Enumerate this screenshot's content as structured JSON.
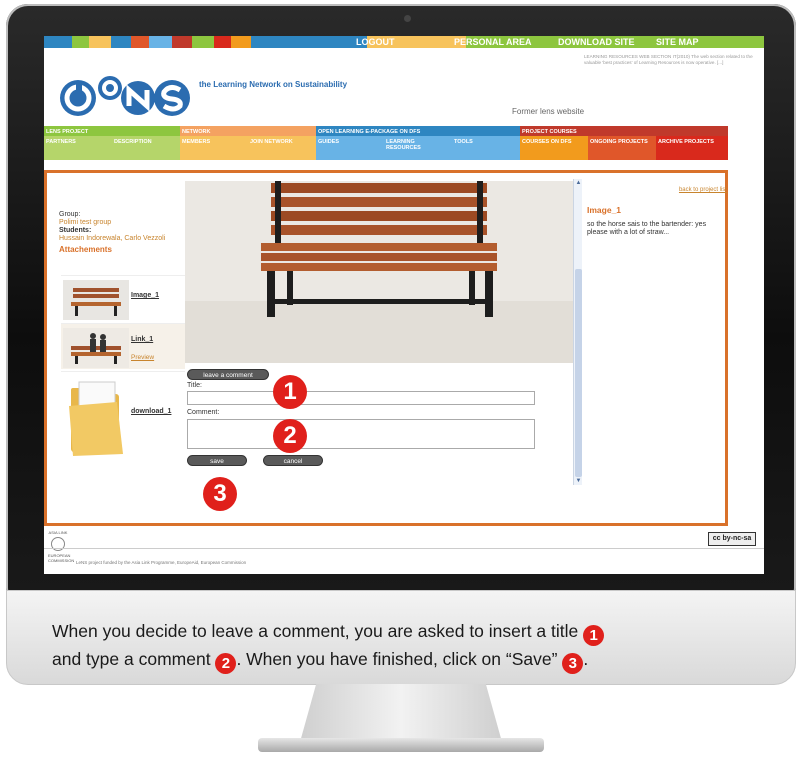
{
  "top_nav": {
    "logout": "LOGOUT",
    "personal_area": "PERSONAL AREA",
    "download_site": "DOWNLOAD SITE",
    "site_map": "SITE MAP"
  },
  "header": {
    "tagline": "the Learning Network on Sustainability",
    "note": "LEARNING RESOURCES WEB SECTION IT(2010) The web section related to the valuable 'best practices' of Learning Resources is now operative. [...]",
    "former_site_link": "Former lens website"
  },
  "menu": {
    "groups": [
      {
        "label": "LENS PROJECT",
        "color": "#8dc63f"
      },
      {
        "label": "NETWORK",
        "color": "#f4a261"
      },
      {
        "label": "OPEN LEARNING E-PACKAGE ON DfS",
        "color": "#2e86c1"
      },
      {
        "label": "PROJECT COURSES",
        "color": "#c0392b"
      }
    ],
    "items": [
      {
        "label": "PARTNERS",
        "color": "#b5d56a"
      },
      {
        "label": "DESCRIPTION",
        "color": "#b5d56a"
      },
      {
        "label": "MEMBERS",
        "color": "#f7c35c"
      },
      {
        "label": "JOIN NETWORK",
        "color": "#f7c35c"
      },
      {
        "label": "GUIDES",
        "color": "#68b3e6"
      },
      {
        "label": "LEARNING RESOURCES",
        "color": "#68b3e6"
      },
      {
        "label": "TOOLS",
        "color": "#68b3e6"
      },
      {
        "label": "COURSES ON DfS",
        "color": "#f29b1d"
      },
      {
        "label": "ONGOING PROJECTS",
        "color": "#e0572a"
      },
      {
        "label": "ARCHIVE PROJECTS",
        "color": "#d9291c"
      }
    ]
  },
  "left": {
    "group_label": "Group:",
    "group_value": "Polimi test group",
    "students_label": "Students:",
    "students_value": "Hussain Indorewala, Carlo Vezzoli",
    "attachments_title": "Attachements",
    "attachments": [
      {
        "link": "Image_1",
        "preview": ""
      },
      {
        "link": "Link_1",
        "preview": "Preview"
      },
      {
        "link": "download_1",
        "preview": ""
      }
    ]
  },
  "right": {
    "back_link": "back to project list",
    "image_title": "Image_1",
    "caption": "so the horse sais to the bartender: yes please with a lot of straw..."
  },
  "form": {
    "leave_comment_button": "leave a comment",
    "title_label": "Title:",
    "title_value": "",
    "comment_label": "Comment:",
    "comment_value": "",
    "save_button": "save",
    "cancel_button": "cancel"
  },
  "badges": {
    "one": "1",
    "two": "2",
    "three": "3"
  },
  "footer": {
    "asia_link": "ASIA LINK",
    "eu_label": "EUROPEAN COMMISSION",
    "funding_text": "LeNS project funded by the Asia Link Programme, EuropeAid, European Commission",
    "cc_label": "cc by-nc-sa"
  },
  "caption": {
    "part1": "When you decide to leave a comment, you are asked to insert a title",
    "part2": "and type a comment",
    "part3": ". When you have finished, click on “Save”",
    "part4": "."
  },
  "colors": {
    "accent_orange": "#d9712a",
    "badge_red": "#e0201b",
    "logo_blue": "#2b6cb0"
  }
}
